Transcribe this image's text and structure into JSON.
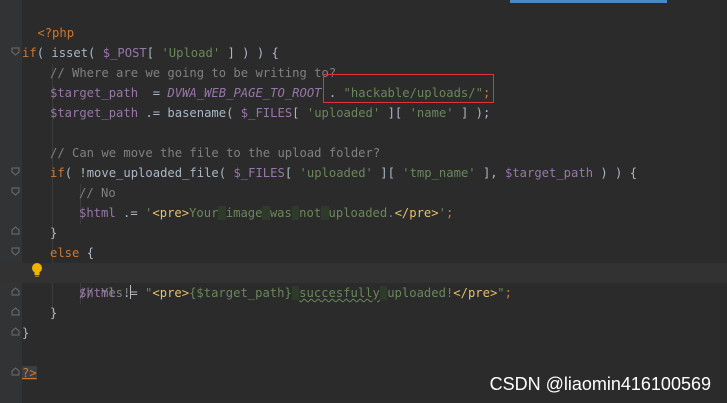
{
  "editor": {
    "language": "php",
    "lines": {
      "l1": "<?php",
      "l3_if": "if",
      "l3_a": "( isset( ",
      "l3_var": "$_POST",
      "l3_b": "[ ",
      "l3_str": "'Upload'",
      "l3_c": " ] ) ) {",
      "l4": "// Where are we going to be writing to?",
      "l5_var": "$target_path",
      "l5_eq": "  = ",
      "l5_const": "DVWA_WEB_PAGE_TO_ROOT",
      "l5_dot": " . ",
      "l5_str": "\"hackable/uploads/\"",
      "l5_semi": ";",
      "l6_var": "$target_path",
      "l6_a": " .= basename( ",
      "l6_files": "$_FILES",
      "l6_b": "[ ",
      "l6_s1": "'uploaded'",
      "l6_c": " ][ ",
      "l6_s2": "'name'",
      "l6_d": " ] );",
      "l8": "// Can we move the file to the upload folder?",
      "l9_if": "if",
      "l9_a": "( !move_uploaded_file( ",
      "l9_files": "$_FILES",
      "l9_b": "[ ",
      "l9_s1": "'uploaded'",
      "l9_c": " ][ ",
      "l9_s2": "'tmp_name'",
      "l9_d": " ], ",
      "l9_var": "$target_path",
      "l9_e": " ) ) {",
      "l10": "// No",
      "l11_var": "$html",
      "l11_a": " .= ",
      "l11_q1": "'",
      "l11_t1": "<pre>",
      "l11_w1": "Your",
      "l11_w2": "image",
      "l11_w3": "was",
      "l11_w4": "not",
      "l11_w5": "uploaded.",
      "l11_t2": "</pre>",
      "l11_q2": "'",
      "l11_semi": ";",
      "l12": "}",
      "l13": "else",
      "l13_b": " {",
      "l14": "// Yes!",
      "l15_var": "$html",
      "l15_a": " .= ",
      "l15_q1": "\"",
      "l15_t1": "<pre>",
      "l15_interp": "{$target_path}",
      "l15_w1": "succesfully",
      "l15_w2": "uploaded!",
      "l15_t2": "</pre>",
      "l15_q2": "\"",
      "l15_semi": ";",
      "l16": "}",
      "l17": "}",
      "l19": "?>"
    },
    "highlight_box_color": "#e0333a"
  },
  "watermark": "CSDN @liaomin416100569"
}
